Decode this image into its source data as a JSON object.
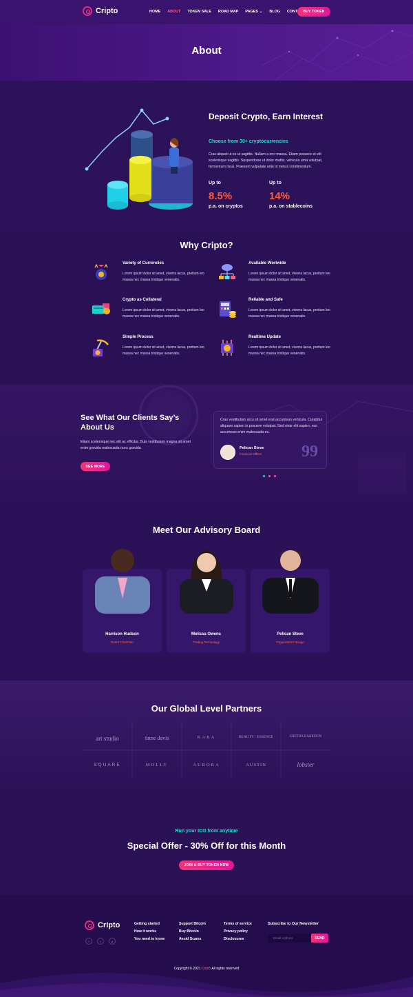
{
  "header": {
    "logo": "Cripto",
    "nav": [
      "HOME",
      "ABOUT",
      "TOKEN SALE",
      "ROAD MAP",
      "PAGES",
      "BLOG",
      "CONTACT"
    ],
    "buy_token": "BUY TOKEN",
    "accent": "#ff5b8a"
  },
  "banner": {
    "title": "About"
  },
  "deposit": {
    "heading": "Deposit Crypto, Earn Interest",
    "subheading": "Choose from 30+ cryptocurrencies",
    "text": "Cras aliquet ut ex ut sagittis. Nullam a orci massa. Etiam posuere et elit scelerisque sagittis. Suspendisse ut dolor mattis, vehicula urna volutpat, fermentum risus. Praesent vulputate ante id metus condimentum.",
    "stats": [
      {
        "up": "Up to",
        "value": "8.5%",
        "label": "p.a. on cryptos"
      },
      {
        "up": "Up to",
        "value": "14%",
        "label": "p.a. on stablecoins"
      }
    ]
  },
  "why": {
    "title": "Why Cripto?",
    "features": [
      {
        "title": "Variety of Currencies",
        "desc": "Lorem ipsum dolor sit amet, viverra lacus, pretium leo massa nec massa tristique venenatis.",
        "icon": "money-bag-icon"
      },
      {
        "title": "Available Worlwide",
        "desc": "Lorem ipsum dolor sit amet, viverra lacus, pretium leo massa nec massa tristique venenatis.",
        "icon": "cloud-network-icon"
      },
      {
        "title": "Crypto as Collateral",
        "desc": "Lorem ipsum dolor sit amet, viverra lacus, pretium leo massa nec massa tristique venenatis.",
        "icon": "card-coin-icon"
      },
      {
        "title": "Reliable and Safe",
        "desc": "Lorem ipsum dolor sit amet, viverra lacus, pretium leo massa nec massa tristique venenatis.",
        "icon": "calculator-coins-icon"
      },
      {
        "title": "Simple Process",
        "desc": "Lorem ipsum dolor sit amet, viverra lacus, pretium leo massa nec massa tristique venenatis.",
        "icon": "mining-pickaxe-icon"
      },
      {
        "title": "Realtime Update",
        "desc": "Lorem ipsum dolor sit amet, viverra lacus, pretium leo massa nec massa tristique venenatis.",
        "icon": "coin-chip-icon"
      }
    ]
  },
  "testimonials": {
    "title": "See What Our Clients Say’s About Us",
    "text": "Etiam scelerisque nec elit ac efficitur. Duis vestibulum magna sit amet enim gravida malesuada nunc gravida",
    "button": "SEE MORE",
    "quote": "Cras vestibulum arcu sit amet erat accumsan vehicula. Curabitur aliquam sapien in posuere volutpat. Sed vinar elit sapien, non accumsan enim malesuada eu.",
    "author": "Pelican Steve",
    "author_role": "Financial Officer",
    "quote_mark": "99"
  },
  "advisory": {
    "title": "Meet Our Advisory Board",
    "members": [
      {
        "name": "Harrison Hudson",
        "role": "Board Chairman"
      },
      {
        "name": "Melissa Owens",
        "role": "Trading Technology"
      },
      {
        "name": "Pelican Steve",
        "role": "Organisation Design"
      }
    ]
  },
  "partners": {
    "title": "Our Global Level Partners",
    "logos": [
      "art studio",
      "fame davis",
      "KARA",
      "BEAUTY · ESSENCE",
      "GRETHA HARRISON",
      "SQUARE",
      "MOLLY",
      "AURORA",
      "AUSTIN",
      "lobster"
    ]
  },
  "offer": {
    "tagline": "Run your ICO from anytime",
    "title": "Special Offer - 30% Off for this Month",
    "button": "JOIN & BUY TOKEN NOW"
  },
  "footer": {
    "logo": "Cripto",
    "col1": [
      "Getting started",
      "How it works",
      "You need to know"
    ],
    "col2": [
      "Support Bitcoin",
      "Buy Bitcoin",
      "Avoid Scams"
    ],
    "col3": [
      "Terms of service",
      "Privacy policy",
      "Disclosures"
    ],
    "newsletter_title": "Subscribe to Our Newsletter",
    "email_placeholder": "Email Address",
    "send": "SEND",
    "copyright_pre": "Copyright © 2021",
    "copyright_brand": "Cripto",
    "copyright_post": "All rights reserved"
  }
}
